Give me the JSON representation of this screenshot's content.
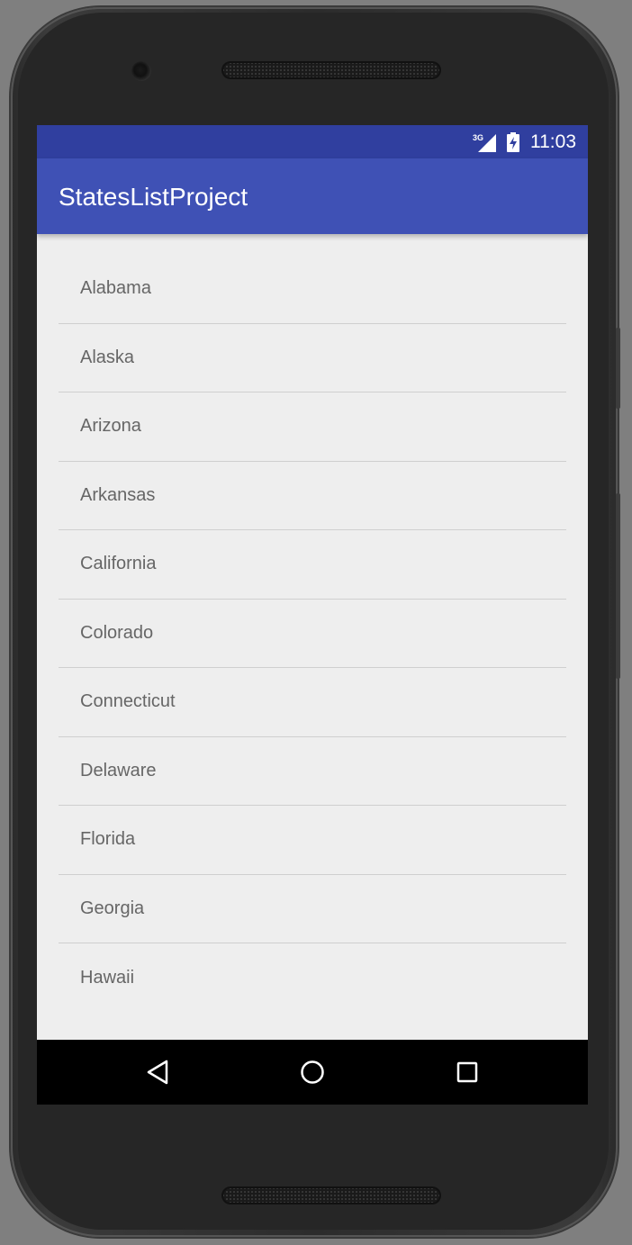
{
  "status_bar": {
    "network_label": "3G",
    "time": "11:03",
    "icons": [
      "signal-3g-icon",
      "battery-charging-icon"
    ]
  },
  "app_bar": {
    "title": "StatesListProject"
  },
  "states": [
    "Alabama",
    "Alaska",
    "Arizona",
    "Arkansas",
    "California",
    "Colorado",
    "Connecticut",
    "Delaware",
    "Florida",
    "Georgia",
    "Hawaii"
  ],
  "navigation": {
    "icons": [
      "back-icon",
      "home-icon",
      "recents-icon"
    ]
  },
  "colors": {
    "status_bar": "#303f9f",
    "primary": "#3f51b5",
    "background": "#eeeeee",
    "item_text": "#666666"
  }
}
